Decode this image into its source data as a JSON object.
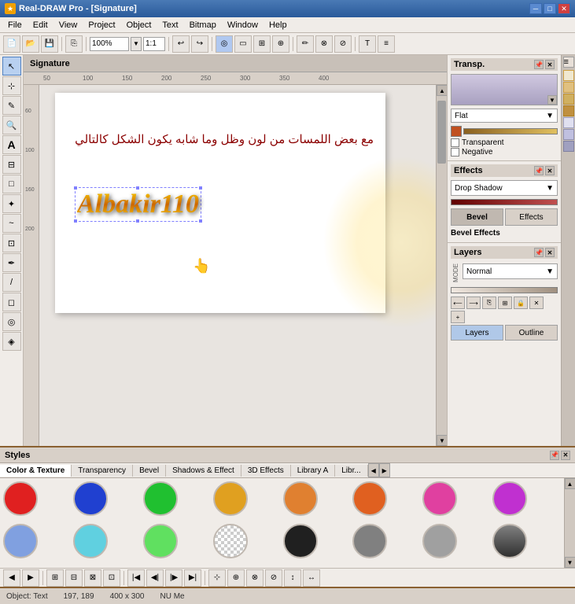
{
  "app": {
    "title": "Real-DRAW Pro - [Signature]",
    "icon": "★"
  },
  "titlebar": {
    "title": "Real-DRAW Pro - [Signature]",
    "min": "─",
    "max": "□",
    "close": "✕"
  },
  "menu": {
    "items": [
      "File",
      "Edit",
      "View",
      "Project",
      "Object",
      "Text",
      "Bitmap",
      "Window",
      "Help"
    ]
  },
  "toolbar": {
    "zoom": "100%",
    "ratio": "1:1"
  },
  "canvas": {
    "title": "Signature",
    "arabic_text": "مع بعض اللمسات من لون وظل وما شابه يكون الشكل كالتالي",
    "golden_text": "Albakir110",
    "ruler_marks": [
      "50",
      "100",
      "150",
      "200",
      "250",
      "300",
      "350",
      "400"
    ]
  },
  "transp_panel": {
    "title": "Transp.",
    "mode": "Flat",
    "transparent_label": "Transparent",
    "negative_label": "Negative"
  },
  "effects_panel": {
    "title": "Effects",
    "dropdown_value": "Drop Shadow",
    "bevel_label": "Bevel",
    "effects_label": "Effects",
    "bevel_effects_title": "Bevel Effects"
  },
  "layers_panel": {
    "title": "Layers",
    "mode": "Normal",
    "layers_tab": "Layers",
    "outline_tab": "Outline"
  },
  "styles_panel": {
    "title": "Styles",
    "tabs": [
      "Color & Texture",
      "Transparency",
      "Bevel",
      "Shadows & Effect",
      "3D Effects",
      "Library A",
      "Libr..."
    ],
    "swatches": [
      {
        "color": "#e02020",
        "name": "red"
      },
      {
        "color": "#2040d0",
        "name": "blue"
      },
      {
        "color": "#20c030",
        "name": "green"
      },
      {
        "color": "#e0a020",
        "name": "yellow-orange"
      },
      {
        "color": "#e08030",
        "name": "orange"
      },
      {
        "color": "#e06020",
        "name": "dark-orange"
      },
      {
        "color": "#e040a0",
        "name": "pink"
      },
      {
        "color": "#c030d0",
        "name": "purple"
      },
      {
        "color": "#80a0e0",
        "name": "light-blue"
      },
      {
        "color": "#60d0e0",
        "name": "cyan"
      },
      {
        "color": "#60e060",
        "name": "light-green"
      },
      {
        "color": "#ffffff",
        "name": "white"
      },
      {
        "color": "#202020",
        "name": "black"
      },
      {
        "color": "#808080",
        "name": "gray"
      },
      {
        "color": "#a0a0a0",
        "name": "light-gray"
      },
      {
        "color": "#606060",
        "name": "dark-gray"
      }
    ]
  },
  "statusbar": {
    "object_type": "Object: Text",
    "coords": "197, 189",
    "dimensions": "400 x 300",
    "mode": "NU Me"
  }
}
